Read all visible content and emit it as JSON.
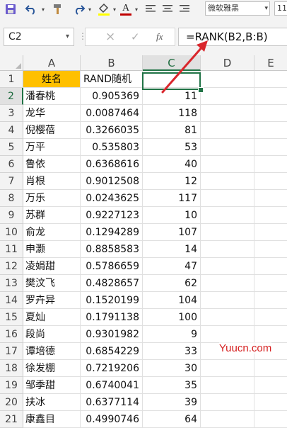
{
  "toolbar": {
    "font_name": "微软雅黑",
    "font_size": "11",
    "icons": [
      "save-icon",
      "undo-icon",
      "format-painter-icon",
      "redo-icon",
      "fill-color-icon",
      "font-color-icon",
      "align-left-icon",
      "align-center-icon",
      "align-right-icon"
    ],
    "accent_fill": "#ffff00",
    "accent_font": "#c00000"
  },
  "formula_bar": {
    "name_box": "C2",
    "cancel_glyph": "×",
    "enter_glyph": "✓",
    "fx_glyph": "fx",
    "formula": "=RANK(B2,B:B)"
  },
  "columns": [
    "A",
    "B",
    "C",
    "D",
    "E"
  ],
  "header_row": {
    "row": "1",
    "a": "姓名",
    "b": "RAND随机",
    "c": "",
    "d": ""
  },
  "rows": [
    {
      "row": "2",
      "a": "潘春桃",
      "b": "0.905369",
      "c": "11"
    },
    {
      "row": "3",
      "a": "龙华",
      "b": "0.0087464",
      "c": "118"
    },
    {
      "row": "4",
      "a": "倪樱蓓",
      "b": "0.3266035",
      "c": "81"
    },
    {
      "row": "5",
      "a": "万平",
      "b": "0.535803",
      "c": "53"
    },
    {
      "row": "6",
      "a": "鲁依",
      "b": "0.6368616",
      "c": "40"
    },
    {
      "row": "7",
      "a": "肖根",
      "b": "0.9012508",
      "c": "12"
    },
    {
      "row": "8",
      "a": "万乐",
      "b": "0.0243625",
      "c": "117"
    },
    {
      "row": "9",
      "a": "苏群",
      "b": "0.9227123",
      "c": "10"
    },
    {
      "row": "10",
      "a": "俞龙",
      "b": "0.1294289",
      "c": "107"
    },
    {
      "row": "11",
      "a": "申灏",
      "b": "0.8858583",
      "c": "14"
    },
    {
      "row": "12",
      "a": "凌娟甜",
      "b": "0.5786659",
      "c": "47"
    },
    {
      "row": "13",
      "a": "樊汶飞",
      "b": "0.4828657",
      "c": "62"
    },
    {
      "row": "14",
      "a": "罗卉异",
      "b": "0.1520199",
      "c": "104"
    },
    {
      "row": "15",
      "a": "夏灿",
      "b": "0.1791138",
      "c": "100"
    },
    {
      "row": "16",
      "a": "段尚",
      "b": "0.9301982",
      "c": "9"
    },
    {
      "row": "17",
      "a": "谭培德",
      "b": "0.6854229",
      "c": "33"
    },
    {
      "row": "18",
      "a": "徐发棚",
      "b": "0.7219206",
      "c": "30"
    },
    {
      "row": "19",
      "a": "邹季甜",
      "b": "0.6740041",
      "c": "35"
    },
    {
      "row": "20",
      "a": "扶冰",
      "b": "0.6377114",
      "c": "39"
    },
    {
      "row": "21",
      "a": "康鑫目",
      "b": "0.4990746",
      "c": "64"
    }
  ],
  "selection": {
    "cell": "C2",
    "border_color": "#217346"
  },
  "header_fill": "#ffc000",
  "annotation_arrow_color": "#d9262c",
  "watermark": "Yuucn.com"
}
